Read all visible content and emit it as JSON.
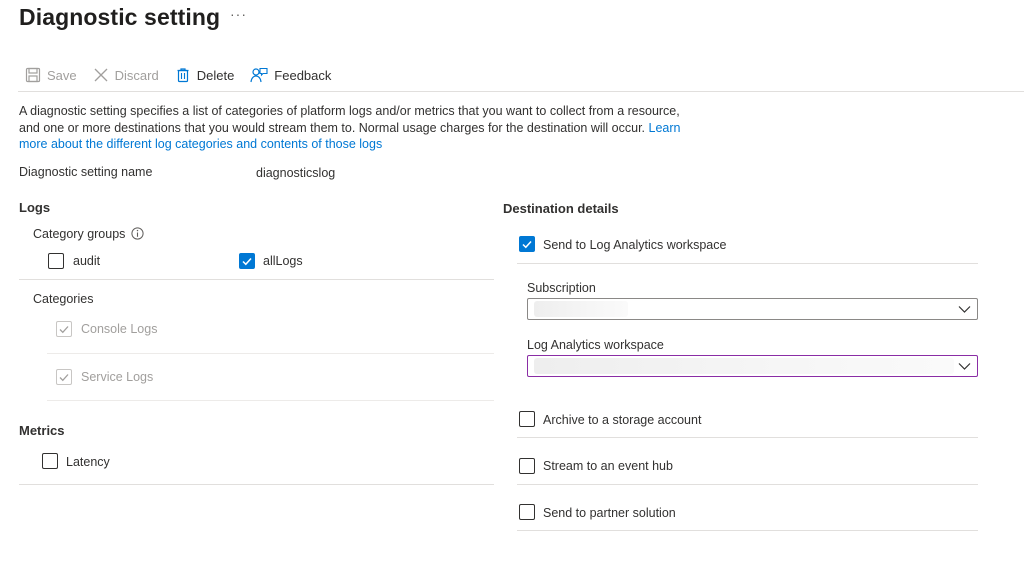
{
  "header": {
    "title": "Diagnostic setting",
    "more": "···"
  },
  "toolbar": {
    "save": "Save",
    "discard": "Discard",
    "delete": "Delete",
    "feedback": "Feedback"
  },
  "description": {
    "text": "A diagnostic setting specifies a list of categories of platform logs and/or metrics that you want to collect from a resource, and one or more destinations that you would stream them to. Normal usage charges for the destination will occur. ",
    "link": "Learn more about the different log categories and contents of those logs"
  },
  "setting_name": {
    "label": "Diagnostic setting name",
    "value": "diagnosticslog"
  },
  "logs": {
    "title": "Logs",
    "category_groups_label": "Category groups",
    "category_groups": [
      {
        "label": "audit",
        "checked": false
      },
      {
        "label": "allLogs",
        "checked": true
      }
    ],
    "categories_label": "Categories",
    "categories": [
      {
        "label": "Console Logs",
        "checked": true,
        "disabled": true
      },
      {
        "label": "Service Logs",
        "checked": true,
        "disabled": true
      }
    ]
  },
  "metrics": {
    "title": "Metrics",
    "items": [
      {
        "label": "Latency",
        "checked": false
      }
    ]
  },
  "destination": {
    "title": "Destination details",
    "log_analytics": {
      "label": "Send to Log Analytics workspace",
      "checked": true
    },
    "subscription_label": "Subscription",
    "workspace_label": "Log Analytics workspace",
    "archive": {
      "label": "Archive to a storage account",
      "checked": false
    },
    "event_hub": {
      "label": "Stream to an event hub",
      "checked": false
    },
    "partner": {
      "label": "Send to partner solution",
      "checked": false
    }
  },
  "colors": {
    "accent": "#0078d4",
    "focus_border": "#8a2da5",
    "disabled": "#a19f9d"
  }
}
